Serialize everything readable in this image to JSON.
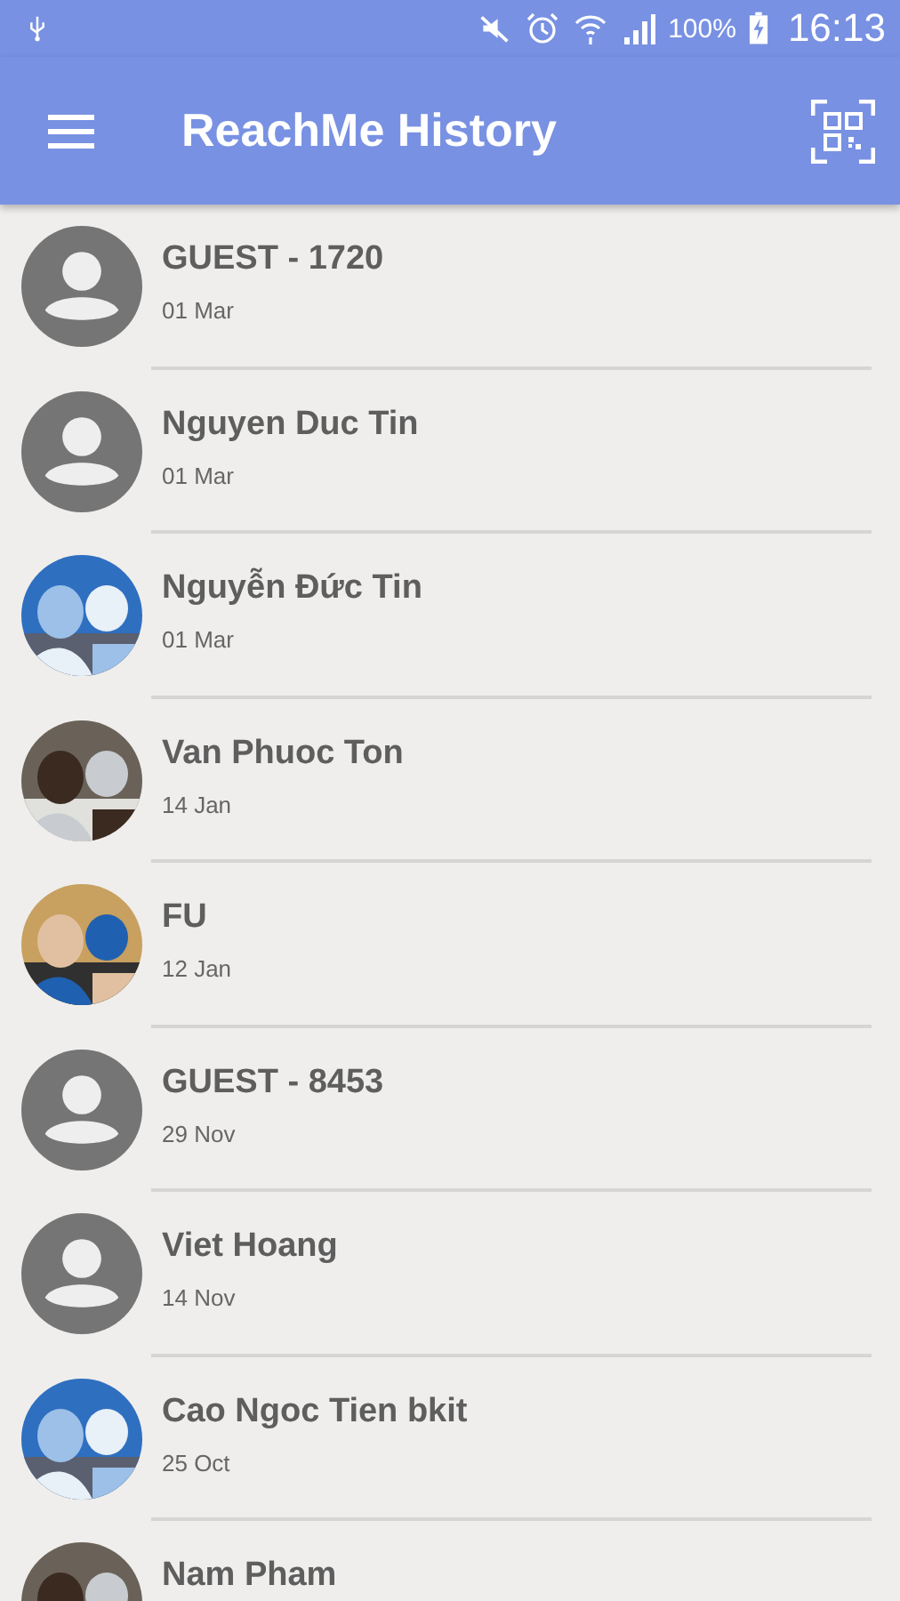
{
  "status_bar": {
    "battery": "100%",
    "time": "16:13"
  },
  "app_bar": {
    "title": "ReachMe History"
  },
  "contacts": [
    {
      "name": "GUEST - 1720",
      "date": "01 Mar",
      "avatar": {
        "kind": "default"
      }
    },
    {
      "name": "Nguyen Duc Tin",
      "date": "01 Mar",
      "avatar": {
        "kind": "default"
      }
    },
    {
      "name": "Nguyễn Đức Tin",
      "date": "01 Mar"
    },
    {
      "name": "Van Phuoc Ton",
      "date": "14 Jan"
    },
    {
      "name": "FU",
      "date": "12 Jan"
    },
    {
      "name": "GUEST - 8453",
      "date": "29 Nov",
      "avatar": {
        "kind": "default"
      }
    },
    {
      "name": "Viet Hoang",
      "date": "14 Nov",
      "avatar": {
        "kind": "default"
      }
    },
    {
      "name": "Cao Ngoc Tien bkit",
      "date": "25 Oct"
    },
    {
      "name": "Nam Pham"
    }
  ]
}
